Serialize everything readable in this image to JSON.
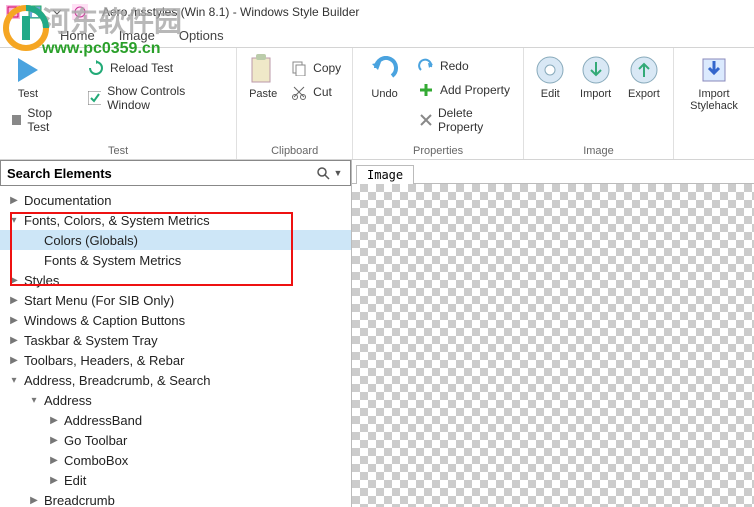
{
  "title": "Aero.msstyles (Win 8.1) - Windows Style Builder",
  "ribbon": {
    "tabs": {
      "home": "Home",
      "image": "Image",
      "options": "Options"
    },
    "test": {
      "group": "Test",
      "test": "Test",
      "reload": "Reload Test",
      "show_controls": "Show Controls Window",
      "stop": "Stop Test"
    },
    "clipboard": {
      "group": "Clipboard",
      "paste": "Paste",
      "copy": "Copy",
      "cut": "Cut"
    },
    "properties": {
      "group": "Properties",
      "undo": "Undo",
      "redo": "Redo",
      "add": "Add Property",
      "delete": "Delete Property"
    },
    "image": {
      "group": "Image",
      "edit": "Edit",
      "import": "Import",
      "export": "Export",
      "import_stylehack": "Import Stylehack"
    }
  },
  "sidebar": {
    "search_label": "Search Elements",
    "items": {
      "documentation": "Documentation",
      "fonts_colors_metrics": "Fonts, Colors, & System Metrics",
      "colors_globals": "Colors (Globals)",
      "fonts_system_metrics": "Fonts & System Metrics",
      "styles": "Styles",
      "start_menu": "Start Menu (For SIB Only)",
      "windows_caption": "Windows & Caption Buttons",
      "taskbar": "Taskbar & System Tray",
      "toolbars": "Toolbars, Headers, & Rebar",
      "address_breadcrumb": "Address, Breadcrumb, & Search",
      "address": "Address",
      "addressband": "AddressBand",
      "go_toolbar": "Go Toolbar",
      "combobox": "ComboBox",
      "edit": "Edit",
      "breadcrumb": "Breadcrumb"
    }
  },
  "right_panel": {
    "tab": "Image"
  },
  "watermark": {
    "site_name": "河东软件园",
    "url": "www.pc0359.cn"
  }
}
